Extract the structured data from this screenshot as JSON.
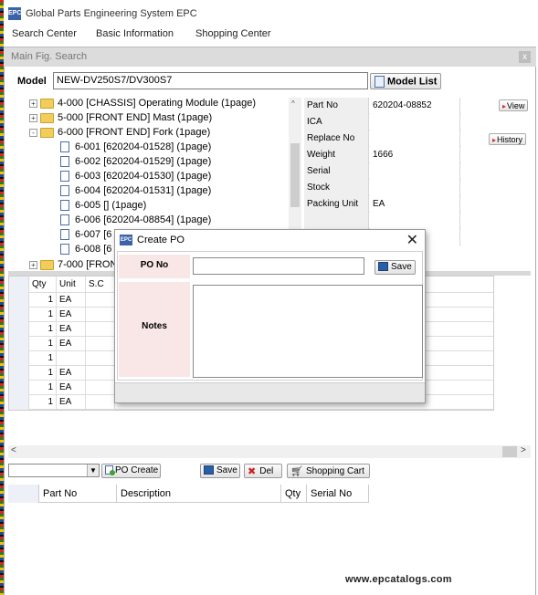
{
  "app": {
    "title": "Global Parts Engineering System EPC",
    "icon_text": "EPC"
  },
  "menu": [
    "Search Center",
    "Basic Information",
    "Shopping Center"
  ],
  "panel": {
    "title": "Main Fig. Search",
    "close": "x"
  },
  "model": {
    "label": "Model",
    "value": "NEW-DV250S7/DV300S7",
    "list_button": "Model List"
  },
  "tree": [
    {
      "type": "folder",
      "expander": "+",
      "label": "4-000 [CHASSIS] Operating Module (1page)"
    },
    {
      "type": "folder",
      "expander": "+",
      "label": "5-000 [FRONT END] Mast (1page)"
    },
    {
      "type": "folder",
      "expander": "-",
      "label": "6-000 [FRONT END] Fork (1page)"
    },
    {
      "type": "doc",
      "label": "6-001 [620204-01528]  (1page)"
    },
    {
      "type": "doc",
      "label": "6-002 [620204-01529]  (1page)"
    },
    {
      "type": "doc",
      "label": "6-003 [620204-01530]  (1page)"
    },
    {
      "type": "doc",
      "label": "6-004 [620204-01531]  (1page)"
    },
    {
      "type": "doc",
      "label": "6-005 []  (1page)"
    },
    {
      "type": "doc",
      "label": "6-006 [620204-08854]  (1page)"
    },
    {
      "type": "doc",
      "label": "6-007 [6"
    },
    {
      "type": "doc",
      "label": "6-008 [6"
    },
    {
      "type": "folder",
      "expander": "+",
      "label": "7-000 [FRON"
    }
  ],
  "properties": [
    {
      "label": "Part No",
      "value": "620204-08852"
    },
    {
      "label": "ICA",
      "value": ""
    },
    {
      "label": "Replace No",
      "value": ""
    },
    {
      "label": "Weight",
      "value": "1666"
    },
    {
      "label": "Serial",
      "value": ""
    },
    {
      "label": "Stock",
      "value": ""
    },
    {
      "label": "Packing Unit",
      "value": "EA"
    },
    {
      "label": "",
      "value": ""
    },
    {
      "label": "",
      "value": ""
    }
  ],
  "prop_buttons": {
    "view": "View",
    "history": "History"
  },
  "parts_table": {
    "headers": [
      "Qty",
      "Unit",
      "S.C"
    ],
    "rows": [
      {
        "qty": "1",
        "unit": "EA"
      },
      {
        "qty": "1",
        "unit": "EA"
      },
      {
        "qty": "1",
        "unit": "EA"
      },
      {
        "qty": "1",
        "unit": "EA"
      },
      {
        "qty": "1",
        "unit": ""
      },
      {
        "qty": "1",
        "unit": "EA"
      },
      {
        "qty": "1",
        "unit": "EA"
      },
      {
        "qty": "1",
        "unit": "EA"
      }
    ]
  },
  "scroll": {
    "left": "<",
    "right": ">",
    "up": "^"
  },
  "toolbar": {
    "po_create": "PO Create",
    "save": "Save",
    "del": "Del",
    "shopping_cart": "Shopping Cart",
    "combo_arrow": "▼"
  },
  "cart_table": {
    "headers": [
      "Part No",
      "Description",
      "Qty",
      "Serial No"
    ]
  },
  "dialog": {
    "title": "Create PO",
    "icon_text": "EPC",
    "close": "✕",
    "po_label": "PO No",
    "po_value": "",
    "save": "Save",
    "notes_label": "Notes",
    "notes_value": ""
  },
  "watermark": "www.epcatalogs.com"
}
